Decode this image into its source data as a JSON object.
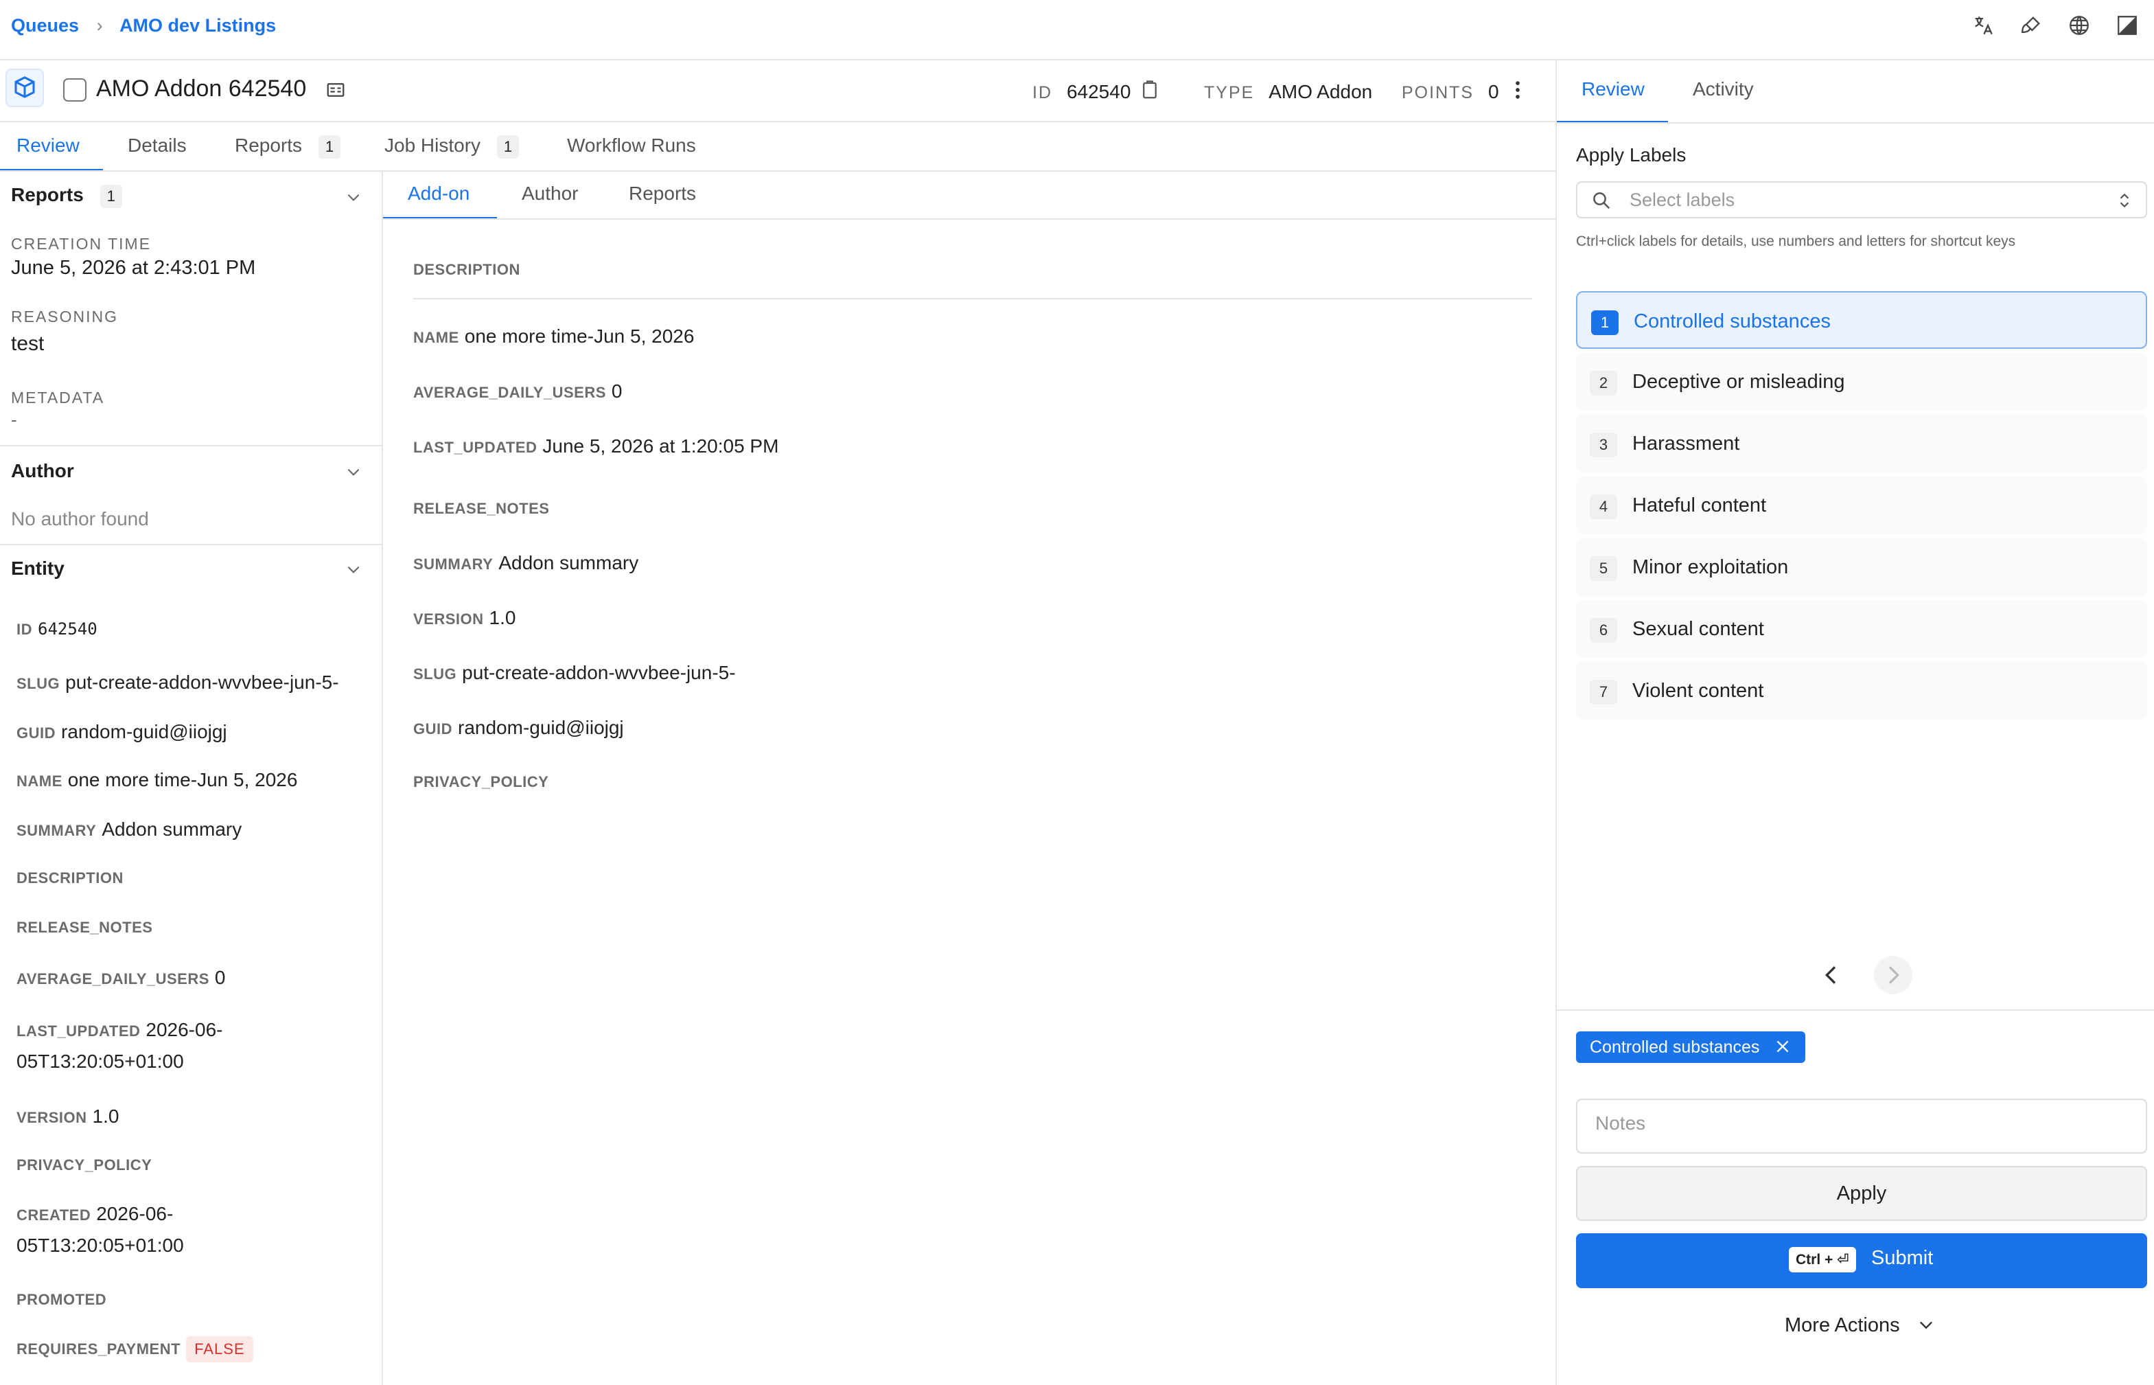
{
  "breadcrumb": {
    "root": "Queues",
    "separator": ">",
    "current": "AMO dev Listings"
  },
  "header": {
    "title": "AMO Addon 642540",
    "id_label": "ID",
    "id_value": "642540",
    "type_label": "TYPE",
    "type_value": "AMO Addon",
    "points_label": "POINTS",
    "points_value": "0"
  },
  "main_tabs": [
    {
      "label": "Review"
    },
    {
      "label": "Details"
    },
    {
      "label": "Reports",
      "count": "1"
    },
    {
      "label": "Job History",
      "count": "1"
    },
    {
      "label": "Workflow Runs"
    }
  ],
  "left": {
    "reports": {
      "title": "Reports",
      "count": "1",
      "creation_label": "CREATION TIME",
      "creation_value": "June 5, 2026 at 2:43:01 PM",
      "reasoning_label": "REASONING",
      "reasoning_value": "test",
      "metadata_label": "METADATA",
      "metadata_value": "-"
    },
    "author": {
      "title": "Author",
      "empty": "No author found"
    },
    "entity": {
      "title": "Entity",
      "fields": [
        {
          "key": "ID",
          "value": "642540"
        },
        {
          "key": "SLUG",
          "value": "put-create-addon-wvvbee-jun-5-"
        },
        {
          "key": "GUID",
          "value": "random-guid@iiojgj"
        },
        {
          "key": "NAME",
          "value": "one more time-Jun 5, 2026"
        },
        {
          "key": "SUMMARY",
          "value": "Addon summary"
        },
        {
          "key": "DESCRIPTION",
          "value": ""
        },
        {
          "key": "RELEASE_NOTES",
          "value": ""
        },
        {
          "key": "AVERAGE_DAILY_USERS",
          "value": "0"
        },
        {
          "key": "LAST_UPDATED",
          "value": "2026-06-",
          "value2": "05T13:20:05+01:00"
        },
        {
          "key": "VERSION",
          "value": "1.0"
        },
        {
          "key": "PRIVACY_POLICY",
          "value": ""
        },
        {
          "key": "CREATED",
          "value": "2026-06-",
          "value2": "05T13:20:05+01:00"
        },
        {
          "key": "PROMOTED",
          "value": ""
        },
        {
          "key": "REQUIRES_PAYMENT",
          "value": "FALSE"
        }
      ]
    }
  },
  "center": {
    "tabs": [
      "Add-on",
      "Author",
      "Reports"
    ],
    "description_label": "DESCRIPTION",
    "fields": [
      {
        "key": "NAME",
        "value": "one more time-Jun 5, 2026"
      },
      {
        "key": "AVERAGE_DAILY_USERS",
        "value": "0"
      },
      {
        "key": "LAST_UPDATED",
        "value": "June 5, 2026 at 1:20:05 PM"
      },
      {
        "key": "RELEASE_NOTES",
        "value": ""
      },
      {
        "key": "SUMMARY",
        "value": "Addon summary"
      },
      {
        "key": "VERSION",
        "value": "1.0"
      },
      {
        "key": "SLUG",
        "value": "put-create-addon-wvvbee-jun-5-"
      },
      {
        "key": "GUID",
        "value": "random-guid@iiojgj"
      },
      {
        "key": "PRIVACY_POLICY",
        "value": ""
      }
    ]
  },
  "right": {
    "tabs": [
      "Review",
      "Activity"
    ],
    "apply_labels_title": "Apply Labels",
    "select_placeholder": "Select labels",
    "hint": "Ctrl+click labels for details, use numbers and letters for shortcut keys",
    "labels": [
      {
        "num": "1",
        "text": "Controlled substances",
        "selected": true
      },
      {
        "num": "2",
        "text": "Deceptive or misleading"
      },
      {
        "num": "3",
        "text": "Harassment"
      },
      {
        "num": "4",
        "text": "Hateful content"
      },
      {
        "num": "5",
        "text": "Minor exploitation"
      },
      {
        "num": "6",
        "text": "Sexual content"
      },
      {
        "num": "7",
        "text": "Violent content"
      }
    ],
    "chip": "Controlled substances",
    "notes_placeholder": "Notes",
    "apply_button": "Apply",
    "submit_kbd": "Ctrl + ⏎",
    "submit_button": "Submit",
    "more_actions": "More Actions"
  },
  "colors": {
    "accent": "#1a73e8",
    "false_badge_bg": "#fde8e8",
    "false_badge_text": "#d93025"
  }
}
